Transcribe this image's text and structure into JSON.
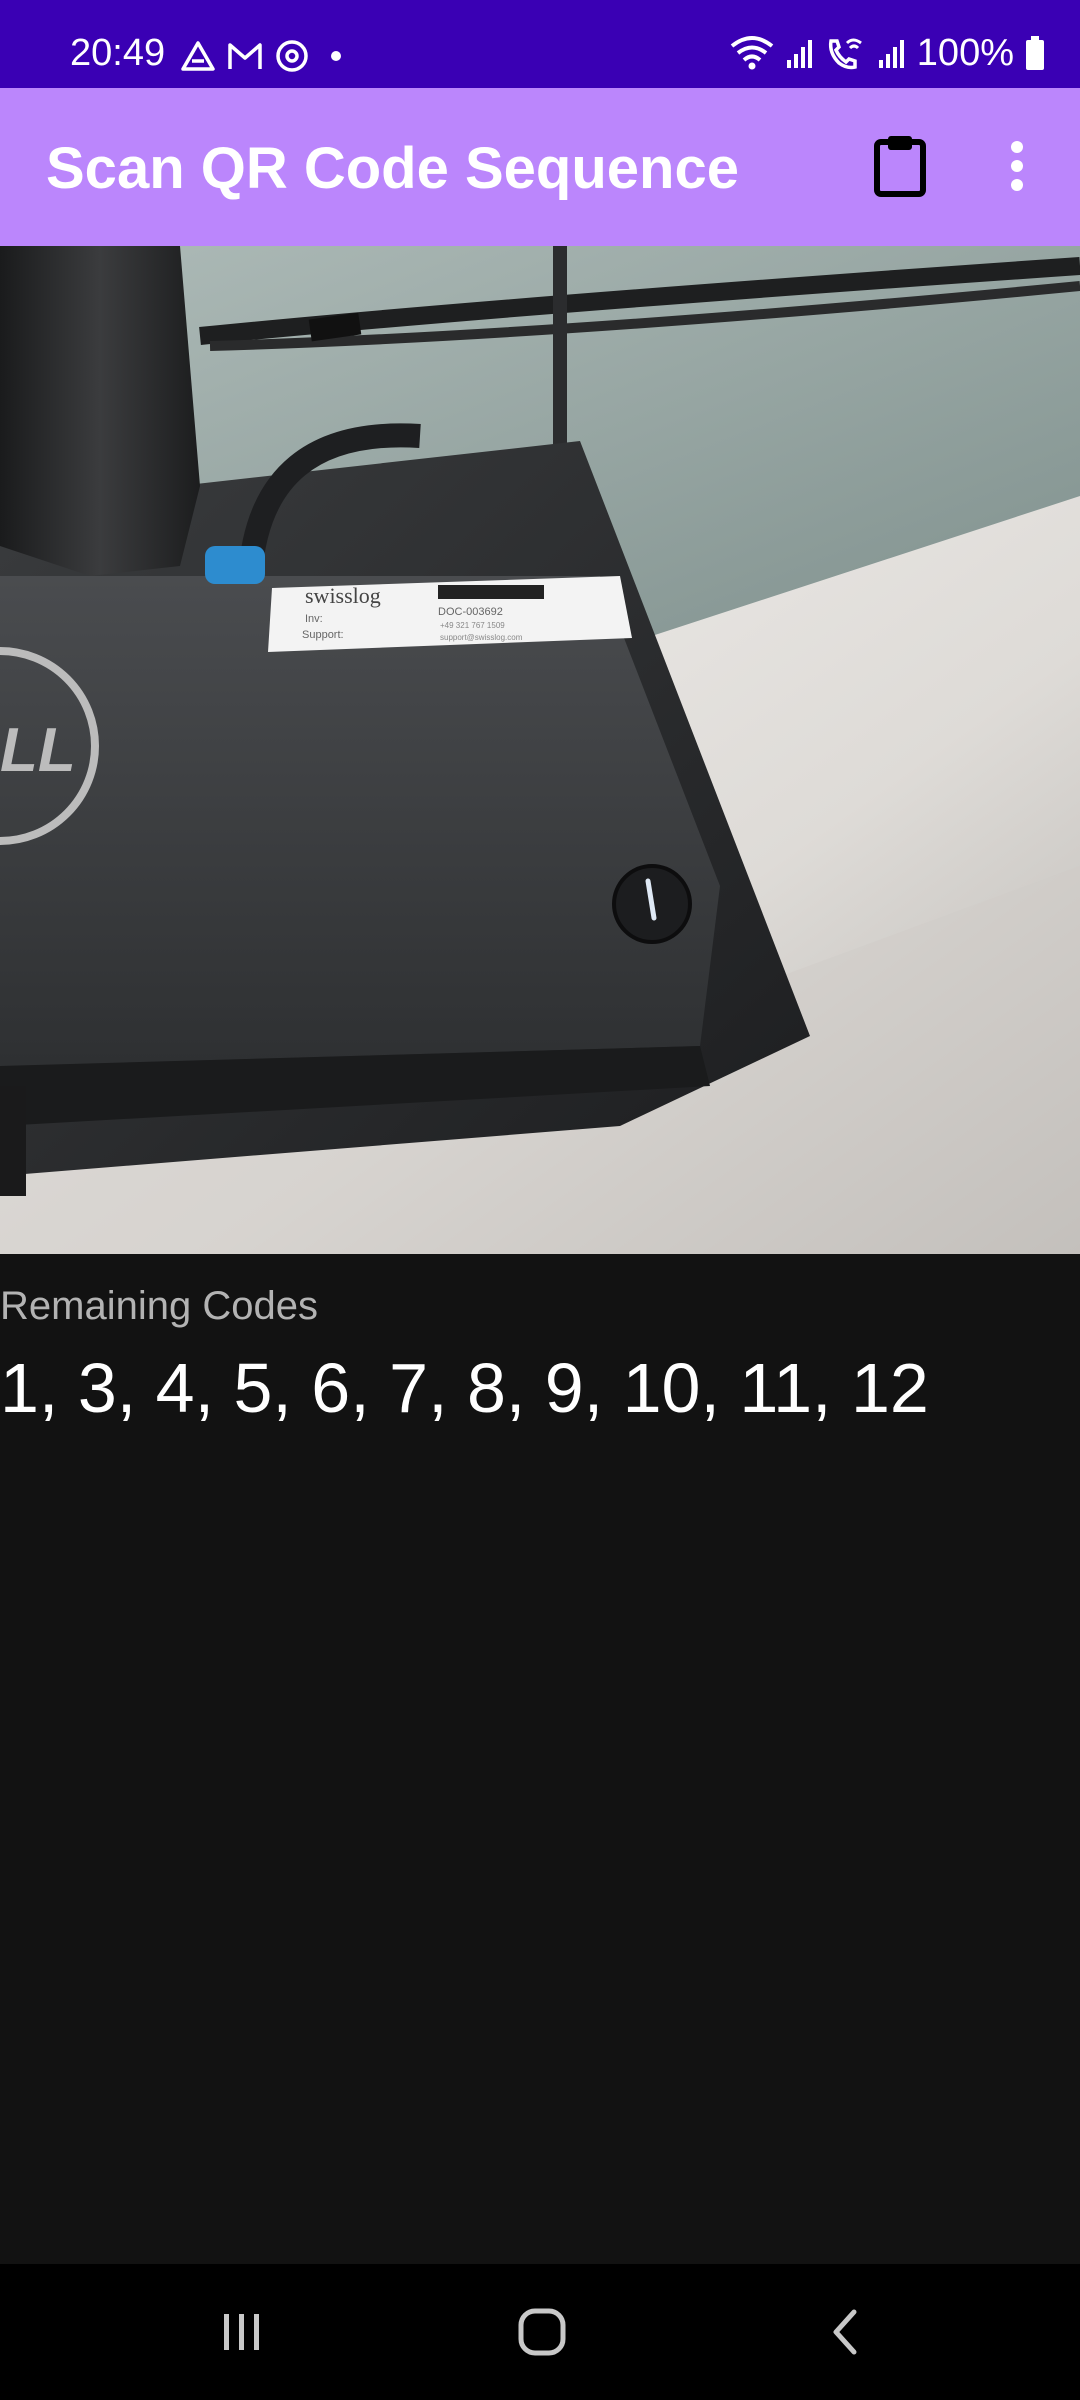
{
  "status_bar": {
    "time": "20:49",
    "battery": "100%",
    "left_icons": [
      "drive-icon",
      "gmail-icon",
      "sync-icon",
      "dot-icon"
    ],
    "right_icons": [
      "wifi-icon",
      "signal-icon",
      "wifi-calling-icon",
      "signal-icon-2",
      "battery-icon"
    ],
    "background": "#3a00b4"
  },
  "app_bar": {
    "title": "Scan QR Code Sequence",
    "actions": [
      "clipboard-icon",
      "more-vert-icon"
    ],
    "background": "#bb86fc"
  },
  "camera": {
    "label_brand": "swisslog",
    "label_inv": "Inv:",
    "label_support": "Support:",
    "label_code": "DOC-003692",
    "label_phone": "+49 321 767 1509",
    "label_email": "support@swisslog.com"
  },
  "main": {
    "remaining_label": "Remaining Codes",
    "remaining_codes": "1, 3, 4, 5, 6, 7, 8, 9, 10, 11, 12"
  },
  "nav_bar": {
    "buttons": [
      "recents-icon",
      "home-icon",
      "back-icon"
    ]
  }
}
